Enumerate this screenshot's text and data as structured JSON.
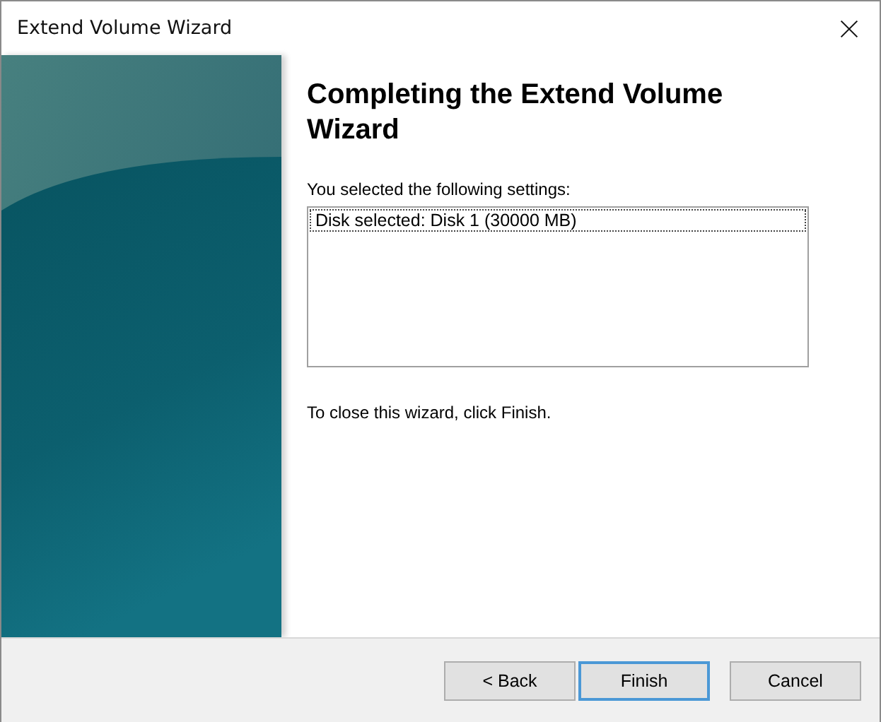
{
  "window": {
    "title": "Extend Volume Wizard"
  },
  "heading": "Completing the Extend Volume Wizard",
  "settings_label": "You selected the following settings:",
  "settings_list": [
    {
      "text": "Disk selected: Disk 1 (30000 MB)",
      "focused": true
    }
  ],
  "closing_note": "To close this wizard, click Finish.",
  "buttons": [
    {
      "label": "< Back",
      "default": false
    },
    {
      "label": "Finish",
      "default": true
    },
    {
      "label": "Cancel",
      "default": false
    }
  ]
}
